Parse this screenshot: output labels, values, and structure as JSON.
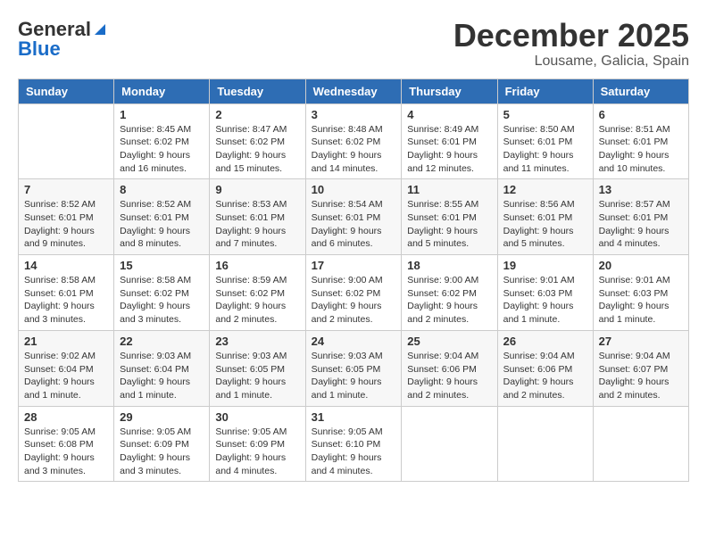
{
  "header": {
    "logo_general": "General",
    "logo_blue": "Blue",
    "month_year": "December 2025",
    "location": "Lousame, Galicia, Spain"
  },
  "weekdays": [
    "Sunday",
    "Monday",
    "Tuesday",
    "Wednesday",
    "Thursday",
    "Friday",
    "Saturday"
  ],
  "weeks": [
    [
      {
        "day": "",
        "sunrise": "",
        "sunset": "",
        "daylight": ""
      },
      {
        "day": "1",
        "sunrise": "Sunrise: 8:45 AM",
        "sunset": "Sunset: 6:02 PM",
        "daylight": "Daylight: 9 hours and 16 minutes."
      },
      {
        "day": "2",
        "sunrise": "Sunrise: 8:47 AM",
        "sunset": "Sunset: 6:02 PM",
        "daylight": "Daylight: 9 hours and 15 minutes."
      },
      {
        "day": "3",
        "sunrise": "Sunrise: 8:48 AM",
        "sunset": "Sunset: 6:02 PM",
        "daylight": "Daylight: 9 hours and 14 minutes."
      },
      {
        "day": "4",
        "sunrise": "Sunrise: 8:49 AM",
        "sunset": "Sunset: 6:01 PM",
        "daylight": "Daylight: 9 hours and 12 minutes."
      },
      {
        "day": "5",
        "sunrise": "Sunrise: 8:50 AM",
        "sunset": "Sunset: 6:01 PM",
        "daylight": "Daylight: 9 hours and 11 minutes."
      },
      {
        "day": "6",
        "sunrise": "Sunrise: 8:51 AM",
        "sunset": "Sunset: 6:01 PM",
        "daylight": "Daylight: 9 hours and 10 minutes."
      }
    ],
    [
      {
        "day": "7",
        "sunrise": "Sunrise: 8:52 AM",
        "sunset": "Sunset: 6:01 PM",
        "daylight": "Daylight: 9 hours and 9 minutes."
      },
      {
        "day": "8",
        "sunrise": "Sunrise: 8:52 AM",
        "sunset": "Sunset: 6:01 PM",
        "daylight": "Daylight: 9 hours and 8 minutes."
      },
      {
        "day": "9",
        "sunrise": "Sunrise: 8:53 AM",
        "sunset": "Sunset: 6:01 PM",
        "daylight": "Daylight: 9 hours and 7 minutes."
      },
      {
        "day": "10",
        "sunrise": "Sunrise: 8:54 AM",
        "sunset": "Sunset: 6:01 PM",
        "daylight": "Daylight: 9 hours and 6 minutes."
      },
      {
        "day": "11",
        "sunrise": "Sunrise: 8:55 AM",
        "sunset": "Sunset: 6:01 PM",
        "daylight": "Daylight: 9 hours and 5 minutes."
      },
      {
        "day": "12",
        "sunrise": "Sunrise: 8:56 AM",
        "sunset": "Sunset: 6:01 PM",
        "daylight": "Daylight: 9 hours and 5 minutes."
      },
      {
        "day": "13",
        "sunrise": "Sunrise: 8:57 AM",
        "sunset": "Sunset: 6:01 PM",
        "daylight": "Daylight: 9 hours and 4 minutes."
      }
    ],
    [
      {
        "day": "14",
        "sunrise": "Sunrise: 8:58 AM",
        "sunset": "Sunset: 6:01 PM",
        "daylight": "Daylight: 9 hours and 3 minutes."
      },
      {
        "day": "15",
        "sunrise": "Sunrise: 8:58 AM",
        "sunset": "Sunset: 6:02 PM",
        "daylight": "Daylight: 9 hours and 3 minutes."
      },
      {
        "day": "16",
        "sunrise": "Sunrise: 8:59 AM",
        "sunset": "Sunset: 6:02 PM",
        "daylight": "Daylight: 9 hours and 2 minutes."
      },
      {
        "day": "17",
        "sunrise": "Sunrise: 9:00 AM",
        "sunset": "Sunset: 6:02 PM",
        "daylight": "Daylight: 9 hours and 2 minutes."
      },
      {
        "day": "18",
        "sunrise": "Sunrise: 9:00 AM",
        "sunset": "Sunset: 6:02 PM",
        "daylight": "Daylight: 9 hours and 2 minutes."
      },
      {
        "day": "19",
        "sunrise": "Sunrise: 9:01 AM",
        "sunset": "Sunset: 6:03 PM",
        "daylight": "Daylight: 9 hours and 1 minute."
      },
      {
        "day": "20",
        "sunrise": "Sunrise: 9:01 AM",
        "sunset": "Sunset: 6:03 PM",
        "daylight": "Daylight: 9 hours and 1 minute."
      }
    ],
    [
      {
        "day": "21",
        "sunrise": "Sunrise: 9:02 AM",
        "sunset": "Sunset: 6:04 PM",
        "daylight": "Daylight: 9 hours and 1 minute."
      },
      {
        "day": "22",
        "sunrise": "Sunrise: 9:03 AM",
        "sunset": "Sunset: 6:04 PM",
        "daylight": "Daylight: 9 hours and 1 minute."
      },
      {
        "day": "23",
        "sunrise": "Sunrise: 9:03 AM",
        "sunset": "Sunset: 6:05 PM",
        "daylight": "Daylight: 9 hours and 1 minute."
      },
      {
        "day": "24",
        "sunrise": "Sunrise: 9:03 AM",
        "sunset": "Sunset: 6:05 PM",
        "daylight": "Daylight: 9 hours and 1 minute."
      },
      {
        "day": "25",
        "sunrise": "Sunrise: 9:04 AM",
        "sunset": "Sunset: 6:06 PM",
        "daylight": "Daylight: 9 hours and 2 minutes."
      },
      {
        "day": "26",
        "sunrise": "Sunrise: 9:04 AM",
        "sunset": "Sunset: 6:06 PM",
        "daylight": "Daylight: 9 hours and 2 minutes."
      },
      {
        "day": "27",
        "sunrise": "Sunrise: 9:04 AM",
        "sunset": "Sunset: 6:07 PM",
        "daylight": "Daylight: 9 hours and 2 minutes."
      }
    ],
    [
      {
        "day": "28",
        "sunrise": "Sunrise: 9:05 AM",
        "sunset": "Sunset: 6:08 PM",
        "daylight": "Daylight: 9 hours and 3 minutes."
      },
      {
        "day": "29",
        "sunrise": "Sunrise: 9:05 AM",
        "sunset": "Sunset: 6:09 PM",
        "daylight": "Daylight: 9 hours and 3 minutes."
      },
      {
        "day": "30",
        "sunrise": "Sunrise: 9:05 AM",
        "sunset": "Sunset: 6:09 PM",
        "daylight": "Daylight: 9 hours and 4 minutes."
      },
      {
        "day": "31",
        "sunrise": "Sunrise: 9:05 AM",
        "sunset": "Sunset: 6:10 PM",
        "daylight": "Daylight: 9 hours and 4 minutes."
      },
      {
        "day": "",
        "sunrise": "",
        "sunset": "",
        "daylight": ""
      },
      {
        "day": "",
        "sunrise": "",
        "sunset": "",
        "daylight": ""
      },
      {
        "day": "",
        "sunrise": "",
        "sunset": "",
        "daylight": ""
      }
    ]
  ]
}
